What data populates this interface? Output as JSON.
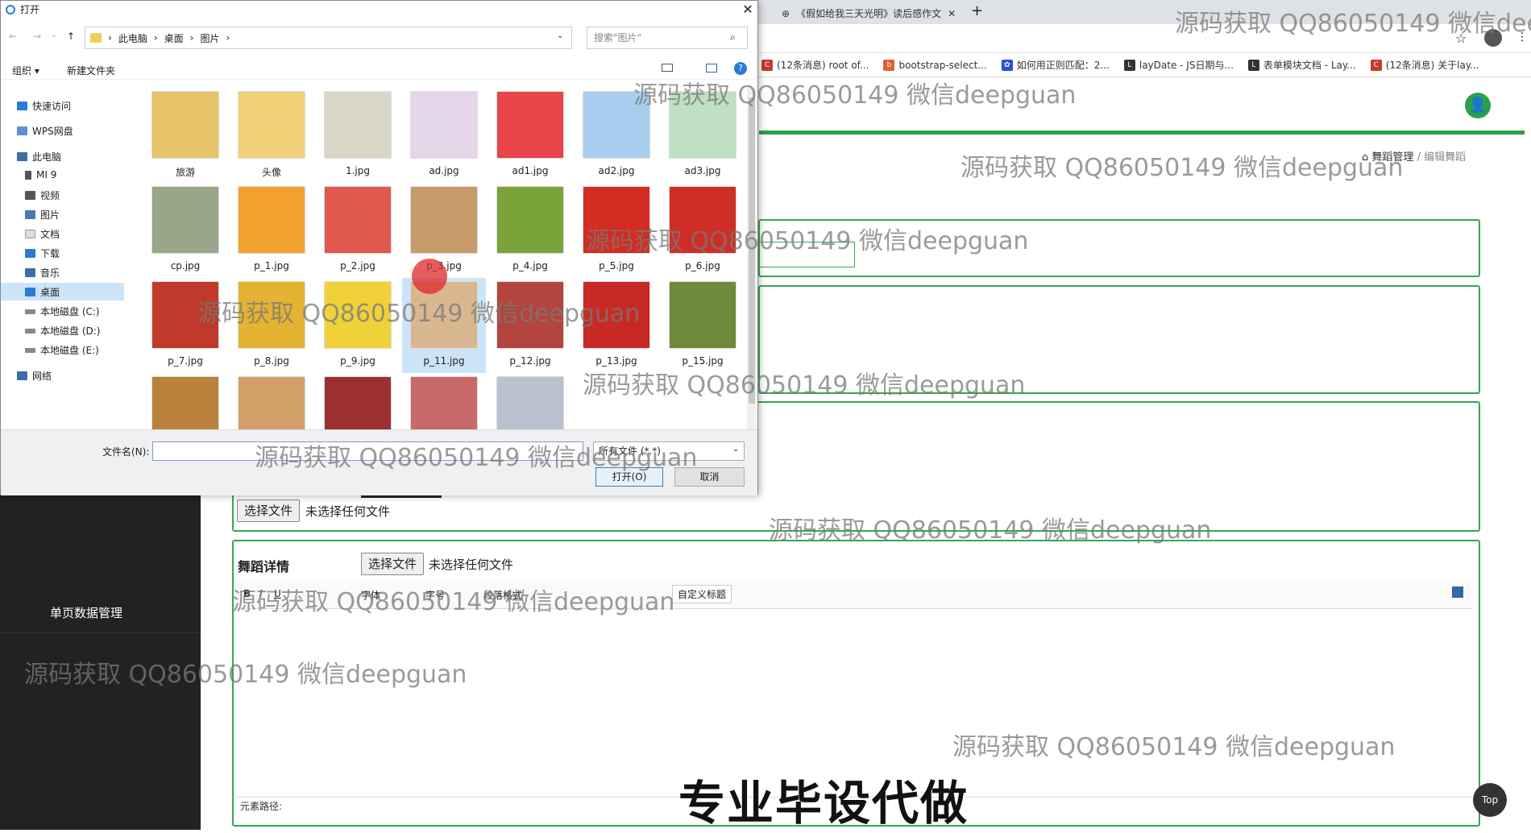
{
  "browser": {
    "tabs": [
      {
        "label": "《假如给我三天光明》读后感作文"
      }
    ],
    "bookmarks": [
      {
        "label": "(12条消息) root of...",
        "icon": "csdn-icon",
        "color": "#c9382e"
      },
      {
        "label": "bootstrap-select...",
        "icon": "bookmark-icon",
        "color": "#e06030"
      },
      {
        "label": "如何用正则匹配：2...",
        "icon": "paw-icon",
        "color": "#2952d9"
      },
      {
        "label": "layDate - JS日期与...",
        "icon": "layui-icon",
        "color": "#333"
      },
      {
        "label": "表单模块文档 - Lay...",
        "icon": "layui-icon",
        "color": "#333"
      },
      {
        "label": "(12条消息) 关于lay...",
        "icon": "csdn-icon",
        "color": "#c9382e"
      }
    ]
  },
  "app": {
    "breadcrumb": {
      "first": "舞蹈管理",
      "sep": "/",
      "current": "编辑舞蹈"
    },
    "sidebar_item": "单页数据管理",
    "file_button": "选择文件",
    "no_file": "未选择任何文件",
    "detail_label": "舞蹈详情",
    "toolbar_items": [
      "字体",
      "字号",
      "段落格式",
      "自定义标题"
    ],
    "element_path": "元素路径:",
    "top_button": "Top",
    "accent": "#2aa04a"
  },
  "dialog": {
    "title": "打开",
    "path": [
      "此电脑",
      "桌面",
      "图片"
    ],
    "search_placeholder": "搜索\"图片\"",
    "organize": "组织 ▾",
    "new_folder": "新建文件夹",
    "nav": {
      "quick": "快速访问",
      "wps": "WPS网盘",
      "pc": "此电脑",
      "items": [
        "MI 9",
        "视频",
        "图片",
        "文档",
        "下载",
        "音乐",
        "桌面",
        "本地磁盘 (C:)",
        "本地磁盘 (D:)",
        "本地磁盘 (E:)"
      ],
      "network": "网络"
    },
    "files": [
      {
        "name": "旅游",
        "color": "#e8c468"
      },
      {
        "name": "头像",
        "color": "#f1d27a"
      },
      {
        "name": "1.jpg",
        "color": "#d9d6c8"
      },
      {
        "name": "ad.jpg",
        "color": "#e6d6ea"
      },
      {
        "name": "ad1.jpg",
        "color": "#e8454a"
      },
      {
        "name": "ad2.jpg",
        "color": "#a9cdee"
      },
      {
        "name": "ad3.jpg",
        "color": "#bfe0c5"
      },
      {
        "name": "cp.jpg",
        "color": "#9aa68a"
      },
      {
        "name": "p_1.jpg",
        "color": "#f2a12d"
      },
      {
        "name": "p_2.jpg",
        "color": "#e0584e"
      },
      {
        "name": "p_3.jpg",
        "color": "#c89a6a"
      },
      {
        "name": "p_4.jpg",
        "color": "#7aa33a"
      },
      {
        "name": "p_5.jpg",
        "color": "#d42c22"
      },
      {
        "name": "p_6.jpg",
        "color": "#cf2e26"
      },
      {
        "name": "p_7.jpg",
        "color": "#c0392b"
      },
      {
        "name": "p_8.jpg",
        "color": "#e5b332"
      },
      {
        "name": "p_9.jpg",
        "color": "#f0d13a"
      },
      {
        "name": "p_11.jpg",
        "color": "#d9b890"
      },
      {
        "name": "p_12.jpg",
        "color": "#b3443e"
      },
      {
        "name": "p_13.jpg",
        "color": "#c72a25"
      },
      {
        "name": "p_15.jpg",
        "color": "#6e8a3a"
      },
      {
        "name": "",
        "color": "#b8823a"
      },
      {
        "name": "",
        "color": "#d4a06a"
      },
      {
        "name": "",
        "color": "#9c3030"
      },
      {
        "name": "",
        "color": "#c86a6a"
      },
      {
        "name": "",
        "color": "#b9c3cf"
      }
    ],
    "selected": "p_11.jpg",
    "filename_label": "文件名(N):",
    "filetype": "所有文件 (*.*)",
    "open_button": "打开(O)",
    "cancel_button": "取消"
  },
  "watermarks": {
    "text": "源码获取 QQ86050149 微信deepguan",
    "clipped": "源码获取 QQ86050149 微信dee"
  },
  "caption": "专业毕设代做"
}
